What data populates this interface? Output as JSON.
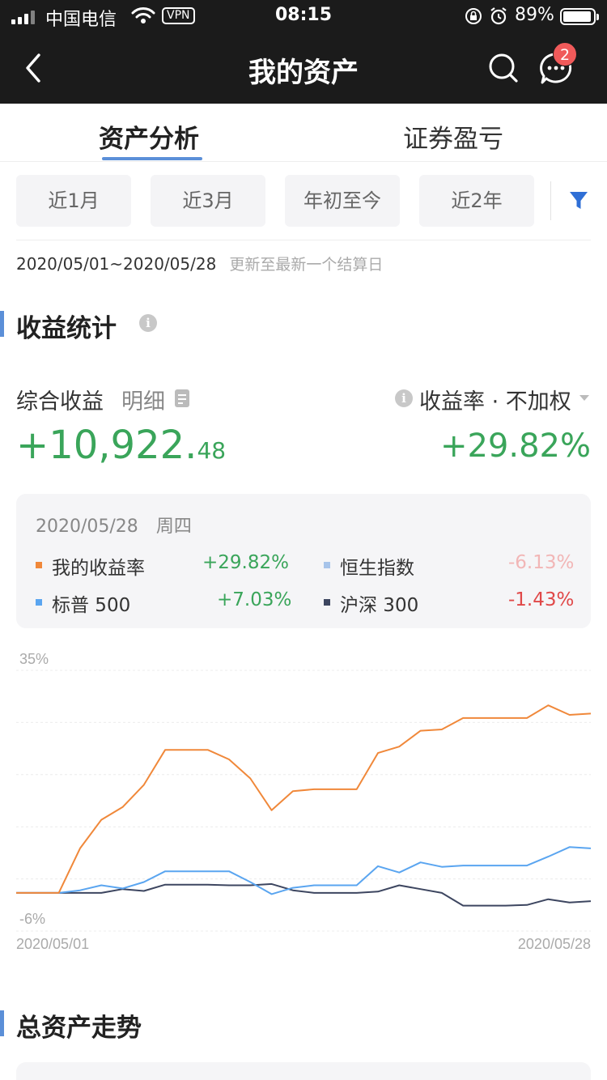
{
  "status_bar": {
    "carrier": "中国电信",
    "vpn": "VPN",
    "time": "08:15",
    "battery": "89%"
  },
  "nav": {
    "title": "我的资产",
    "badge_count": "2"
  },
  "tabs": [
    {
      "label": "资产分析",
      "active": true
    },
    {
      "label": "证券盈亏",
      "active": false
    }
  ],
  "ranges": [
    "近1月",
    "近3月",
    "年初至今",
    "近2年"
  ],
  "date_range": "2020/05/01~2020/05/28",
  "date_note": "更新至最新一个结算日",
  "section1": {
    "title": "收益统计"
  },
  "summary": {
    "label": "综合收益",
    "detail": "明细",
    "rate_label": "收益率 · 不加权",
    "value_int": "+10,922.",
    "value_dec": "48",
    "rate": "+29.82%"
  },
  "legend": {
    "date": "2020/05/28",
    "weekday": "周四",
    "items": [
      {
        "name": "我的收益率",
        "value": "+29.82%",
        "color": "#f0883a",
        "value_color": "#3aa55a"
      },
      {
        "name": "恒生指数",
        "value": "-6.13%",
        "color": "#a7c4ea",
        "value_color": "#f2b6b6"
      },
      {
        "name": "标普 500",
        "value": "+7.03%",
        "color": "#5aa5f0",
        "value_color": "#3aa55a"
      },
      {
        "name": "沪深 300",
        "value": "-1.43%",
        "color": "#3d4660",
        "value_color": "#e04848"
      }
    ]
  },
  "chart_data": {
    "type": "line",
    "ylim": [
      -6,
      35
    ],
    "y_tick_labels": [
      "35%",
      "-6%"
    ],
    "x_tick_labels": [
      "2020/05/01",
      "2020/05/28"
    ],
    "series": [
      {
        "name": "我的收益率",
        "color": "#f0883a",
        "values": [
          0,
          0,
          0,
          7,
          11.5,
          13.5,
          17,
          22.5,
          22.5,
          22.5,
          21,
          18,
          13,
          16,
          16.3,
          16.3,
          16.3,
          22,
          23,
          25.5,
          25.7,
          27.5,
          27.5,
          27.5,
          27.5,
          29.5,
          28,
          28.2
        ]
      },
      {
        "name": "标普 500",
        "color": "#5aa5f0",
        "values": [
          0,
          0,
          0,
          0.4,
          1.2,
          0.7,
          1.7,
          3.4,
          3.4,
          3.4,
          3.4,
          1.7,
          -0.2,
          0.8,
          1.2,
          1.2,
          1.2,
          4.2,
          3.2,
          4.8,
          4.1,
          4.3,
          4.3,
          4.3,
          4.3,
          5.7,
          7.2,
          7.0
        ]
      },
      {
        "name": "沪深 300",
        "color": "#3d4660",
        "values": [
          0,
          0,
          0,
          0,
          0,
          0.6,
          0.3,
          1.3,
          1.3,
          1.3,
          1.2,
          1.2,
          1.4,
          0.4,
          0,
          0,
          0,
          0.2,
          1.2,
          0.6,
          0,
          -2.0,
          -2.0,
          -2.0,
          -1.9,
          -1.0,
          -1.5,
          -1.3
        ]
      }
    ]
  },
  "section2": {
    "title": "总资产走势"
  }
}
